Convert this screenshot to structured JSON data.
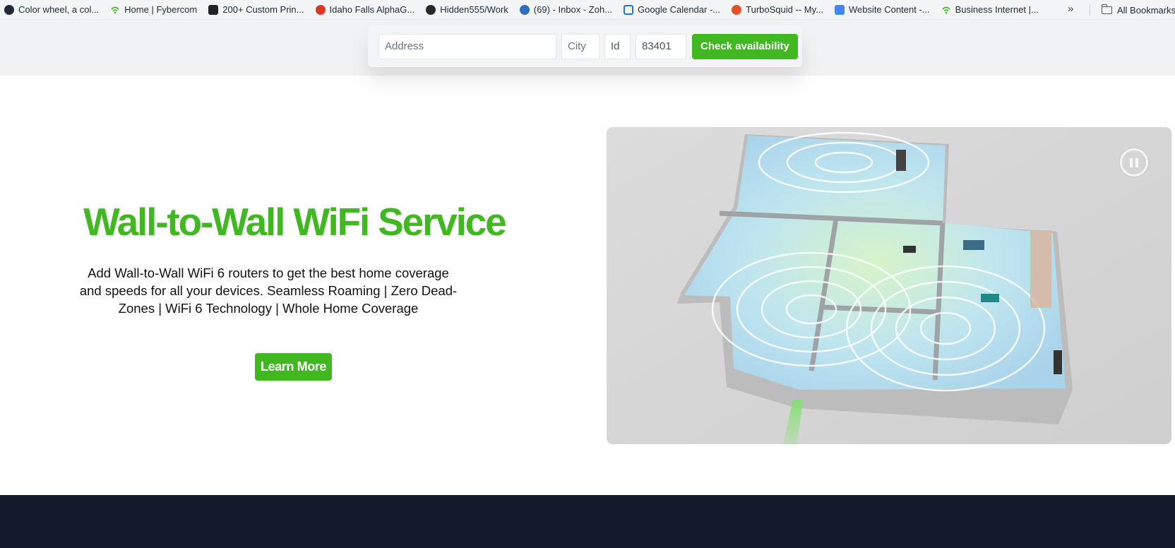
{
  "bookmarks_bar": {
    "items": [
      {
        "label": "Color wheel, a col...",
        "icon": "color-wheel-icon",
        "color": "#1f2937"
      },
      {
        "label": "Home | Fybercom",
        "icon": "wifi-icon",
        "color": "#41b822"
      },
      {
        "label": "200+ Custom Prin...",
        "icon": "print-icon",
        "color": "#222222"
      },
      {
        "label": "Idaho Falls AlphaG...",
        "icon": "ag-icon",
        "color": "#d93b2b"
      },
      {
        "label": "Hidden555/Work",
        "icon": "github-icon",
        "color": "#24292f"
      },
      {
        "label": "(69) - Inbox - Zoh...",
        "icon": "mail-icon",
        "color": "#2f6fc0"
      },
      {
        "label": "Google Calendar -...",
        "icon": "calendar-icon",
        "color": "#1a73e8"
      },
      {
        "label": "TurboSquid -- My...",
        "icon": "turbosquid-icon",
        "color": "#e4502a"
      },
      {
        "label": "Website Content -...",
        "icon": "docs-icon",
        "color": "#4285f4"
      },
      {
        "label": "Business Internet |...",
        "icon": "wifi-icon",
        "color": "#41b822"
      }
    ],
    "more": "»",
    "all_bookmarks": "All Bookmarks"
  },
  "availability": {
    "address_placeholder": "Address",
    "city_placeholder": "City",
    "state_value": "Id",
    "zip_value": "83401",
    "button_label": "Check availability"
  },
  "hero": {
    "title": "Wall-to-Wall WiFi Service",
    "description": "Add Wall-to-Wall WiFi 6 routers to get the best home coverage and speeds for all your devices. Seamless Roaming | Zero Dead-Zones | WiFi 6 Technology | Whole Home Coverage",
    "cta_label": "Learn More"
  },
  "media": {
    "image_subject": "wifi-floorplan-illustration",
    "control_icon": "pause-icon"
  },
  "colors": {
    "brand_green": "#41b822",
    "dark_navy": "#131a2b",
    "strip_gray": "#f1f2f4"
  }
}
